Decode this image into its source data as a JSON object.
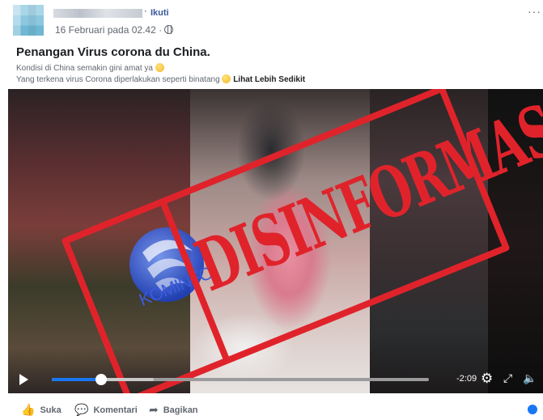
{
  "post": {
    "follow_separator": "·",
    "follow_label": "Ikuti",
    "date": "16 Februari pada 02.42 ·",
    "more_options": "···",
    "title": "Penangan Virus corona du China.",
    "line1": "Kondisi di China semakin gini amat ya",
    "line2": "Yang terkena virus Corona diperlakukan seperti binatang",
    "see_more": "Lihat Lebih Sedikit"
  },
  "video": {
    "stamp_text": "DISINFORMASI",
    "logo_text": "KOMINFO",
    "remaining_time": "-2:09",
    "progress_fraction": 0.13,
    "buffered_fraction": 0.27
  },
  "actions": {
    "like": "Suka",
    "comment": "Komentari",
    "share": "Bagikan"
  },
  "colors": {
    "stamp_red": "#e0232b",
    "link_blue": "#385898",
    "progress_blue": "#1877f2",
    "kominfo_blue": "#3b5bdb"
  },
  "icons": [
    "avatar",
    "globe-icon",
    "more-icon",
    "emoji-icon",
    "play-icon",
    "settings-icon",
    "fullscreen-icon",
    "volume-icon",
    "like-icon",
    "comment-icon",
    "share-icon"
  ]
}
